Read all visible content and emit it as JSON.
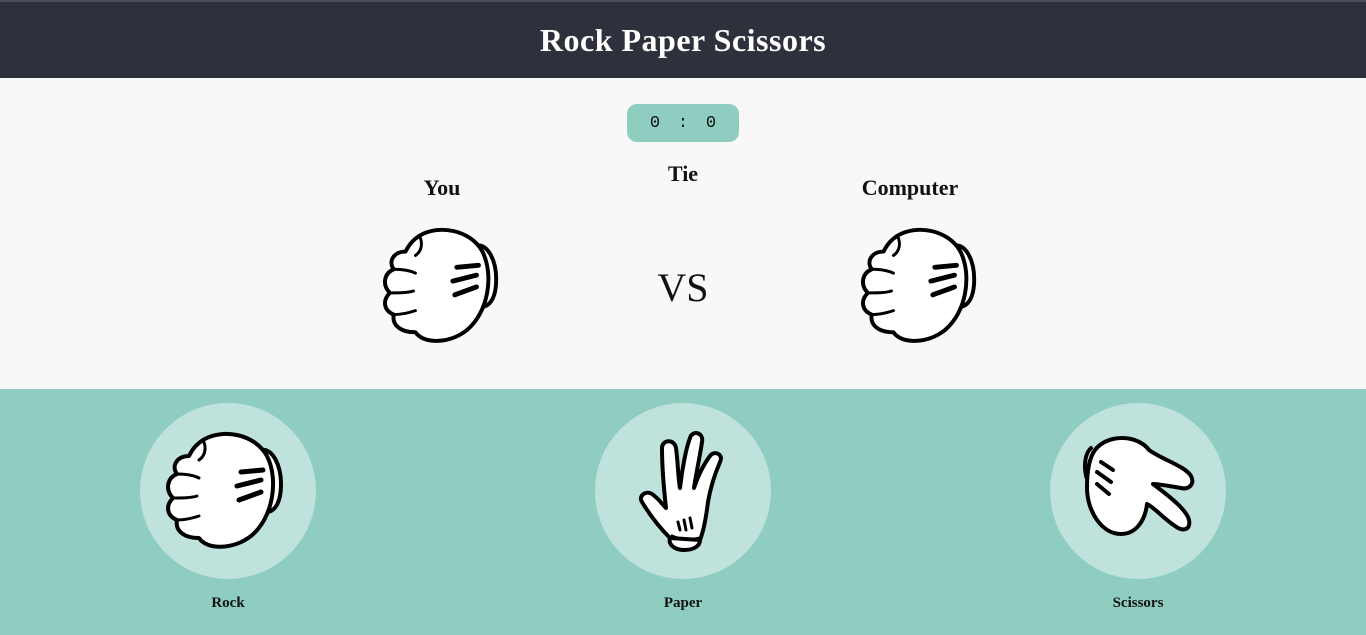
{
  "header": {
    "title": "Rock Paper Scissors"
  },
  "score": {
    "player": "0",
    "separator": ":",
    "computer": "0"
  },
  "arena": {
    "player_label": "You",
    "result": "Tie",
    "vs": "VS",
    "computer_label": "Computer",
    "player_choice_icon": "rock-fist-icon",
    "computer_choice_icon": "rock-fist-icon"
  },
  "choices": [
    {
      "label": "Rock",
      "icon": "rock-fist-icon"
    },
    {
      "label": "Paper",
      "icon": "paper-open-hand-icon"
    },
    {
      "label": "Scissors",
      "icon": "scissors-hand-icon"
    }
  ],
  "colors": {
    "header_bg": "#2e303b",
    "arena_bg": "#f8f8f8",
    "accent": "#8fcdc1",
    "choice_circle": "#bfe3dc"
  }
}
